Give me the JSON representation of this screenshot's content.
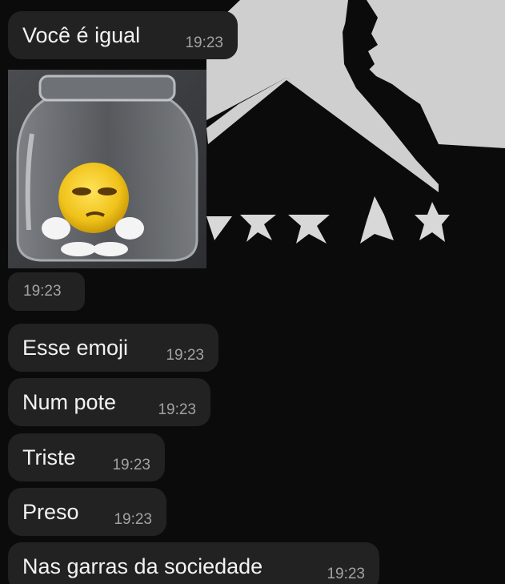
{
  "chat": {
    "messages": [
      {
        "text": "Você é igual",
        "time": "19:23"
      },
      {
        "text": "Esse emoji",
        "time": "19:23"
      },
      {
        "text": "Num pote",
        "time": "19:23"
      },
      {
        "text": "Triste",
        "time": "19:23"
      },
      {
        "text": "Preso",
        "time": "19:23"
      },
      {
        "text": "Nas garras da sociedade",
        "time": "19:23"
      }
    ],
    "image_message": {
      "time": "19:23",
      "content": "sad emoji in a jar"
    }
  },
  "colors": {
    "background": "#0b0b0b",
    "bubble": "#222222",
    "text": "#f2f2f2",
    "time": "#a2a2a2",
    "wallpaper_art": "#cfcfcf"
  }
}
